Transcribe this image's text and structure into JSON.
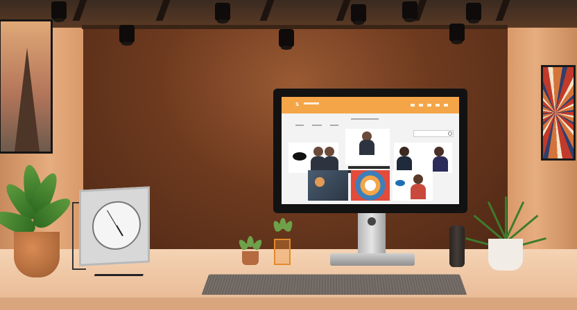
{
  "scene": {
    "description_colors": {
      "back_wall": "#6e3a1f",
      "side_walls": "#e6ad7e",
      "screen_header": "#f4a548"
    }
  },
  "clock": {
    "hour_hand_angle": 150,
    "minute_hand_angle": 330
  },
  "screen": {
    "logo_glyph": "S"
  }
}
